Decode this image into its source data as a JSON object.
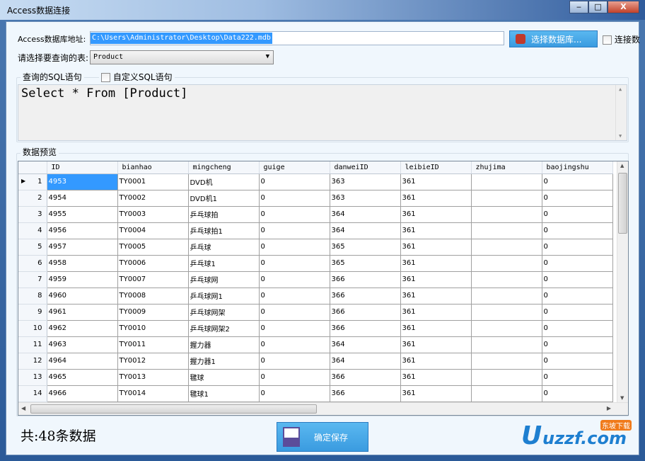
{
  "window": {
    "title": "Access数据连接",
    "minimize": "‒",
    "maximize": "□",
    "close": "X"
  },
  "form": {
    "db_path_label": "Access数据库地址:",
    "db_path_value": "C:\\Users\\Administrator\\Desktop\\Data222.mdb",
    "choose_db_button": "选择数据库...",
    "connect_checkbox_label": "连接数",
    "table_label": "请选择要查询的表:",
    "table_selected": "Product",
    "sql_group_label": "查询的SQL语句",
    "custom_sql_label": "自定义SQL语句",
    "sql_text": "Select * From [Product]",
    "preview_label": "数据预览",
    "count_text": "共:48条数据",
    "save_button": "确定保存"
  },
  "grid": {
    "columns": [
      "ID",
      "bianhao",
      "mingcheng",
      "guige",
      "danweiID",
      "leibieID",
      "zhujima",
      "baojingshu"
    ],
    "rows": [
      [
        "1",
        "4953",
        "TY0001",
        "DVD机",
        "0",
        "363",
        "361",
        "",
        "0"
      ],
      [
        "2",
        "4954",
        "TY0002",
        "DVD机1",
        "0",
        "363",
        "361",
        "",
        "0"
      ],
      [
        "3",
        "4955",
        "TY0003",
        "乒乓球拍",
        "0",
        "364",
        "361",
        "",
        "0"
      ],
      [
        "4",
        "4956",
        "TY0004",
        "乒乓球拍1",
        "0",
        "364",
        "361",
        "",
        "0"
      ],
      [
        "5",
        "4957",
        "TY0005",
        "乒乓球",
        "0",
        "365",
        "361",
        "",
        "0"
      ],
      [
        "6",
        "4958",
        "TY0006",
        "乒乓球1",
        "0",
        "365",
        "361",
        "",
        "0"
      ],
      [
        "7",
        "4959",
        "TY0007",
        "乒乓球网",
        "0",
        "366",
        "361",
        "",
        "0"
      ],
      [
        "8",
        "4960",
        "TY0008",
        "乒乓球网1",
        "0",
        "366",
        "361",
        "",
        "0"
      ],
      [
        "9",
        "4961",
        "TY0009",
        "乒乓球网架",
        "0",
        "366",
        "361",
        "",
        "0"
      ],
      [
        "10",
        "4962",
        "TY0010",
        "乒乓球网架2",
        "0",
        "366",
        "361",
        "",
        "0"
      ],
      [
        "11",
        "4963",
        "TY0011",
        "握力器",
        "0",
        "364",
        "361",
        "",
        "0"
      ],
      [
        "12",
        "4964",
        "TY0012",
        "握力器1",
        "0",
        "364",
        "361",
        "",
        "0"
      ],
      [
        "13",
        "4965",
        "TY0013",
        "毽球",
        "0",
        "366",
        "361",
        "",
        "0"
      ],
      [
        "14",
        "4966",
        "TY0014",
        "毽球1",
        "0",
        "366",
        "361",
        "",
        "0"
      ]
    ]
  },
  "watermark": {
    "text": "uzzf.com",
    "badge": "东坡下载"
  }
}
